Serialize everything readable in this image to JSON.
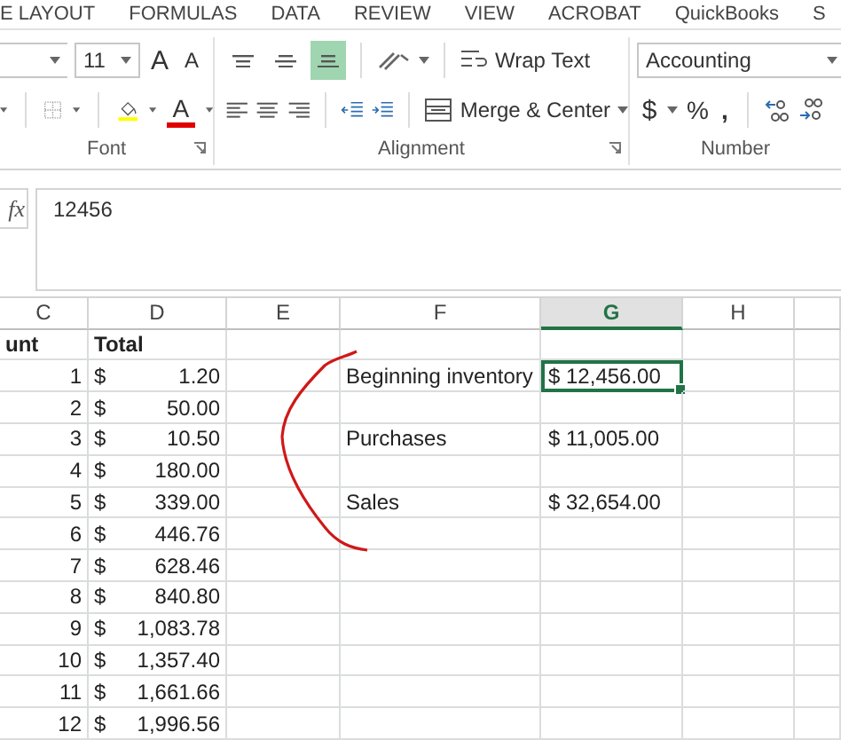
{
  "ribbon_tabs": [
    "E LAYOUT",
    "FORMULAS",
    "DATA",
    "REVIEW",
    "VIEW",
    "ACROBAT",
    "QuickBooks",
    "S"
  ],
  "font_group": {
    "label": "Font",
    "font_size": "11",
    "grow_font": "A",
    "shrink_font": "A",
    "font_color": "A"
  },
  "alignment_group": {
    "label": "Alignment",
    "vertical_align": [
      {
        "kind": "top",
        "selected": false
      },
      {
        "kind": "middle",
        "selected": false
      },
      {
        "kind": "bottom",
        "selected": true
      }
    ],
    "wrap_text": "Wrap Text",
    "merge_center": "Merge & Center"
  },
  "number_group": {
    "label": "Number",
    "format": "Accounting",
    "currency": "$",
    "percent": "%",
    "comma": ","
  },
  "formula_bar": {
    "fx": "fx",
    "value": "12456"
  },
  "sheet": {
    "columns": [
      {
        "label": "C",
        "selected": false
      },
      {
        "label": "D",
        "selected": false
      },
      {
        "label": "E",
        "selected": false
      },
      {
        "label": "F",
        "selected": false
      },
      {
        "label": "G",
        "selected": true
      },
      {
        "label": "H",
        "selected": false
      }
    ],
    "rows": [
      {
        "kind": "header",
        "c": "unt",
        "d": "Total"
      },
      {
        "c": "1",
        "d_currency": "$",
        "d_amount": "1.20",
        "f": "Beginning inventory",
        "g": "$ 12,456.00",
        "g_selected": true
      },
      {
        "c": "2",
        "d_currency": "$",
        "d_amount": "50.00"
      },
      {
        "c": "3",
        "d_currency": "$",
        "d_amount": "10.50",
        "f": "Purchases",
        "g": "$ 11,005.00",
        "g_selected": false
      },
      {
        "c": "4",
        "d_currency": "$",
        "d_amount": "180.00"
      },
      {
        "c": "5",
        "d_currency": "$",
        "d_amount": "339.00",
        "f": "Sales",
        "g": "$ 32,654.00",
        "g_selected": false
      },
      {
        "c": "6",
        "d_currency": "$",
        "d_amount": "446.76"
      },
      {
        "c": "7",
        "d_currency": "$",
        "d_amount": "628.46"
      },
      {
        "c": "8",
        "d_currency": "$",
        "d_amount": "840.80"
      },
      {
        "c": "9",
        "d_currency": "$",
        "d_amount": "1,083.78"
      },
      {
        "c": "10",
        "d_currency": "$",
        "d_amount": "1,357.40"
      },
      {
        "c": "11",
        "d_currency": "$",
        "d_amount": "1,661.66"
      },
      {
        "c": "12",
        "d_currency": "$",
        "d_amount": "1,996.56"
      }
    ]
  }
}
